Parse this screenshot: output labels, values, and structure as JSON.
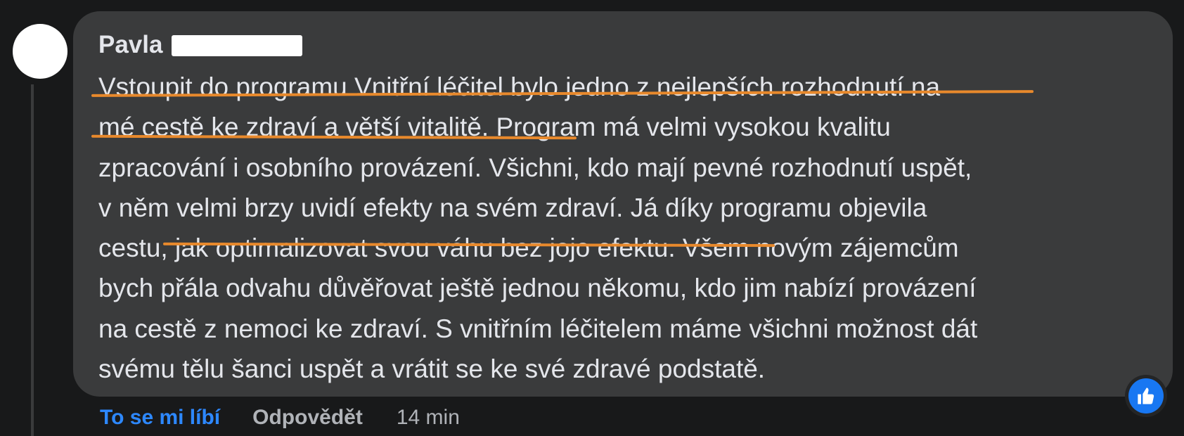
{
  "comment": {
    "author": "Pavla",
    "body_lines": [
      "Vstoupit do programu Vnitřní léčitel bylo jedno z nejlepších rozhodnutí na",
      "mé cestě ke zdraví a větší vitalitě. Program má velmi vysokou kvalitu",
      "zpracování i osobního provázení. Všichni, kdo mají pevné rozhodnutí uspět,",
      "v něm velmi brzy uvidí efekty na svém zdraví. Já díky programu objevila",
      "cestu, jak optimalizovat svou váhu bez jojo efektu. Všem novým zájemcům",
      "bych přála odvahu důvěřovat ještě jednou někomu, kdo jim nabízí provázení",
      "na cestě z nemoci ke zdraví. S vnitřním léčitelem máme všichni možnost dát",
      "svému tělu šanci uspět a vrátit se ke své zdravé podstatě."
    ]
  },
  "actions": {
    "like_label": "To se mi líbí",
    "reply_label": "Odpovědět",
    "timestamp": "14 min"
  },
  "reaction": {
    "icon": "thumbs-up-icon",
    "color": "#1877f2"
  },
  "colors": {
    "background": "#18191a",
    "bubble": "#3a3b3c",
    "text": "#e4e6eb",
    "muted": "#b0b3b8",
    "link": "#2d88ff",
    "highlight": "#e8892c"
  }
}
